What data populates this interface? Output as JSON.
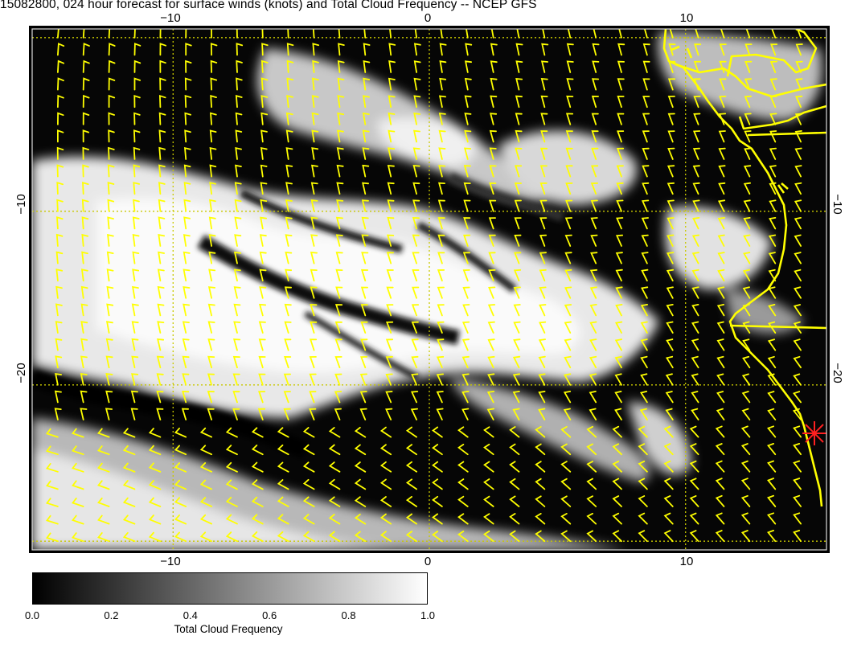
{
  "title": "15082800, 024 hour forecast for surface winds (knots) and Total Cloud Frequency -- NCEP GFS",
  "map": {
    "lon_range": [
      -15.5,
      15.5
    ],
    "lat_range": [
      -29.5,
      0.5
    ],
    "top_ticks": [
      "−10",
      "0",
      "10"
    ],
    "bottom_ticks": [
      "−10",
      "0",
      "10"
    ],
    "left_ticks": [
      "−10",
      "−20"
    ],
    "right_ticks": [
      "−10",
      "−20"
    ],
    "gridline_color": "#c8c800",
    "barb_color": "#ffff00",
    "coastline_color": "#ffff00",
    "marker_color": "#ff2020",
    "marker_icon": "asterisk-marker-icon"
  },
  "colorbar": {
    "label": "Total Cloud Frequency",
    "ticks": [
      "0.0",
      "0.2",
      "0.4",
      "0.6",
      "0.8",
      "1.0"
    ],
    "range": [
      0,
      1
    ],
    "colormap": "grayscale-black-to-white"
  }
}
